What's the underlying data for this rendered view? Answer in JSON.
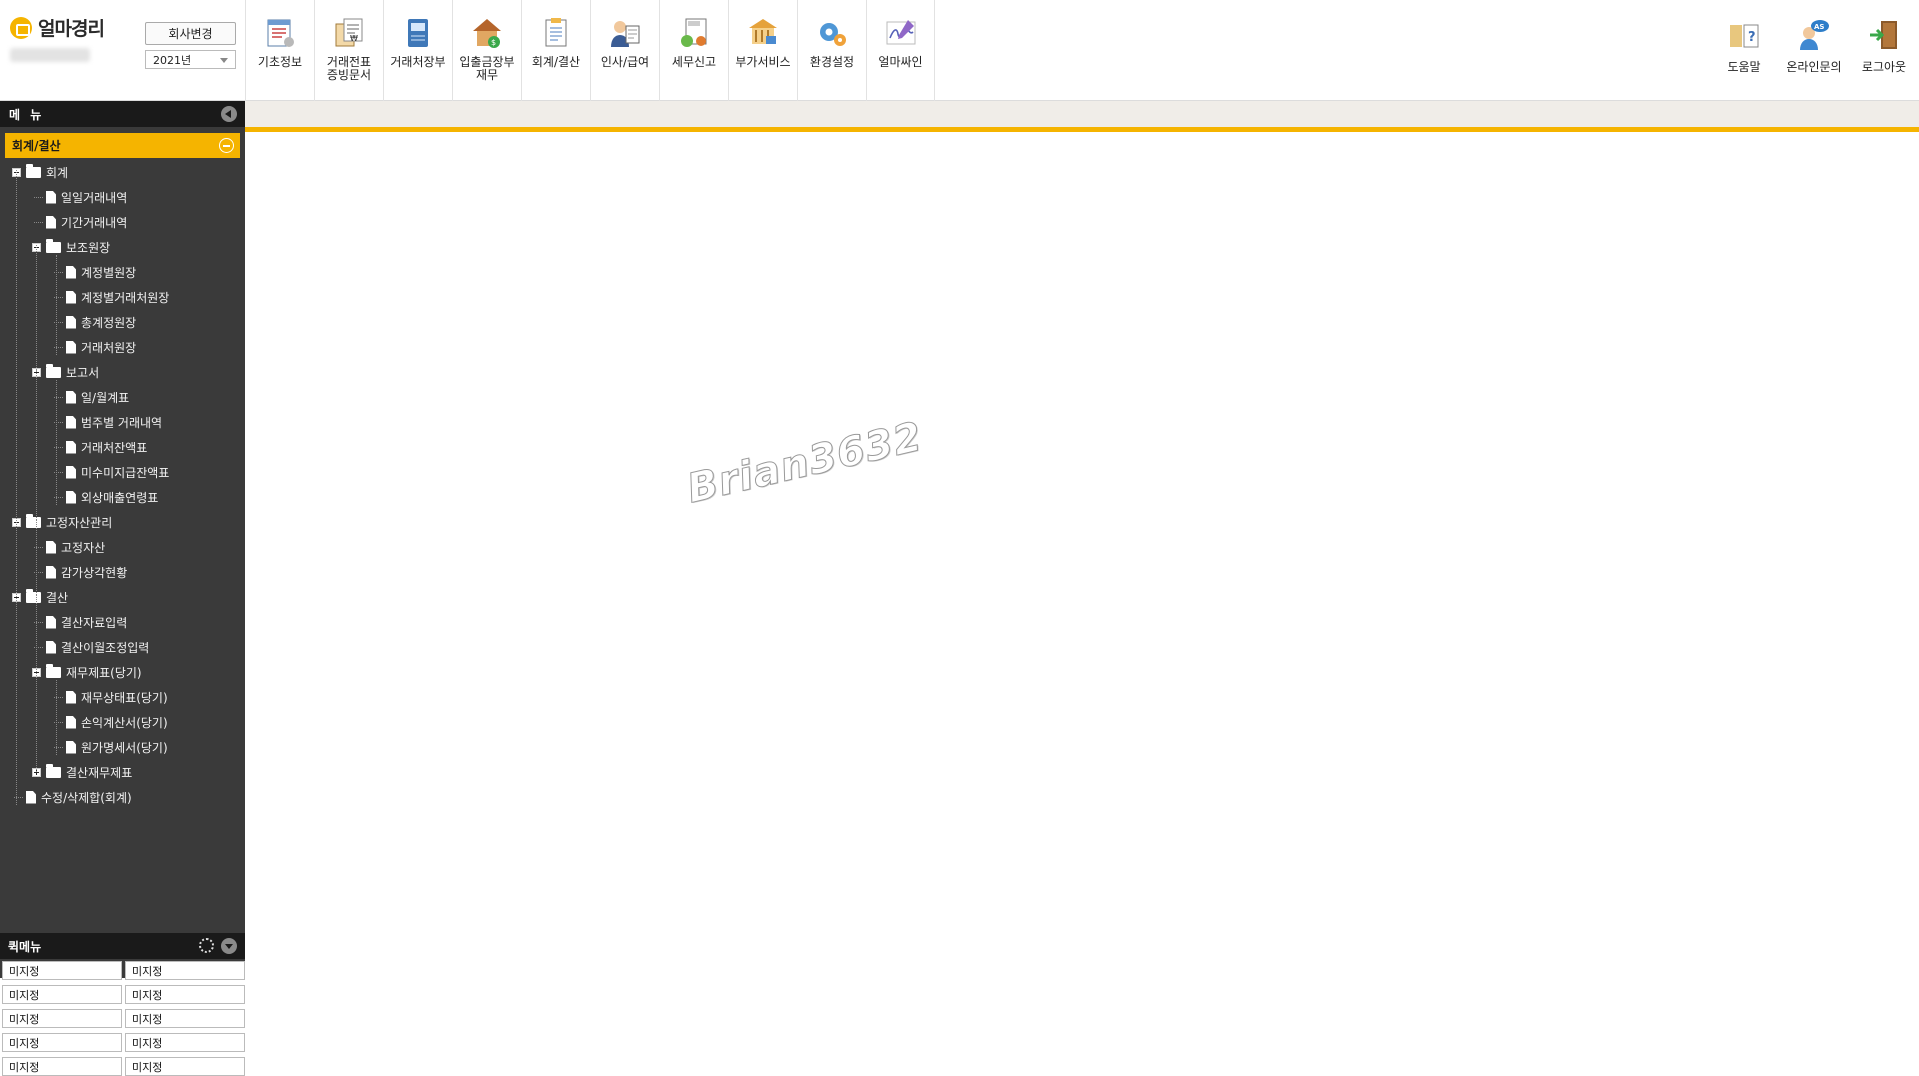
{
  "app": {
    "logo_text": "얼마경리"
  },
  "header": {
    "company_change": "회사변경",
    "year": "2021년"
  },
  "toolbar": [
    {
      "label": "기초정보",
      "icon": "basic-info-icon"
    },
    {
      "label": "거래전표\n증빙문서",
      "icon": "voucher-document-icon"
    },
    {
      "label": "거래처장부",
      "icon": "client-ledger-icon"
    },
    {
      "label": "입출금장부\n재무",
      "icon": "cashbook-finance-icon"
    },
    {
      "label": "회계/결산",
      "icon": "accounting-closing-icon"
    },
    {
      "label": "인사/급여",
      "icon": "hr-payroll-icon"
    },
    {
      "label": "세무신고",
      "icon": "tax-report-icon"
    },
    {
      "label": "부가서비스",
      "icon": "additional-service-icon"
    },
    {
      "label": "환경설정",
      "icon": "settings-icon"
    },
    {
      "label": "얼마싸인",
      "icon": "esign-icon"
    }
  ],
  "right_tools": [
    {
      "label": "도움말",
      "icon": "help-book-icon"
    },
    {
      "label": "온라인문의",
      "icon": "online-inquiry-icon"
    },
    {
      "label": "로그아웃",
      "icon": "logout-door-icon"
    }
  ],
  "sidebar": {
    "title": "메 뉴",
    "section": "회계/결산",
    "tree": [
      {
        "label": "회계",
        "type": "folder",
        "level": 0,
        "expanded": true
      },
      {
        "label": "일일거래내역",
        "type": "doc",
        "level": 1
      },
      {
        "label": "기간거래내역",
        "type": "doc",
        "level": 1
      },
      {
        "label": "보조원장",
        "type": "folder",
        "level": 1,
        "expanded": true
      },
      {
        "label": "계정별원장",
        "type": "doc",
        "level": 2
      },
      {
        "label": "계정별거래처원장",
        "type": "doc",
        "level": 2
      },
      {
        "label": "총계정원장",
        "type": "doc",
        "level": 2
      },
      {
        "label": "거래처원장",
        "type": "doc",
        "level": 2
      },
      {
        "label": "보고서",
        "type": "folder",
        "level": 1,
        "expanded": true
      },
      {
        "label": "일/월계표",
        "type": "doc",
        "level": 2
      },
      {
        "label": "범주별 거래내역",
        "type": "doc",
        "level": 2
      },
      {
        "label": "거래처잔액표",
        "type": "doc",
        "level": 2
      },
      {
        "label": "미수미지급잔액표",
        "type": "doc",
        "level": 2
      },
      {
        "label": "외상매출연령표",
        "type": "doc",
        "level": 2
      },
      {
        "label": "고정자산관리",
        "type": "folder",
        "level": 0,
        "expanded": true
      },
      {
        "label": "고정자산",
        "type": "doc",
        "level": 1
      },
      {
        "label": "감가상각현황",
        "type": "doc",
        "level": 1
      },
      {
        "label": "결산",
        "type": "folder",
        "level": 0,
        "expanded": true
      },
      {
        "label": "결산자료입력",
        "type": "doc",
        "level": 1
      },
      {
        "label": "결산이월조정입력",
        "type": "doc",
        "level": 1
      },
      {
        "label": "재무제표(당기)",
        "type": "folder",
        "level": 1,
        "expanded": true
      },
      {
        "label": "재무상태표(당기)",
        "type": "doc",
        "level": 2
      },
      {
        "label": "손익계산서(당기)",
        "type": "doc",
        "level": 2
      },
      {
        "label": "원가명세서(당기)",
        "type": "doc",
        "level": 2
      },
      {
        "label": "결산재무제표",
        "type": "folder",
        "level": 1,
        "expanded": false
      },
      {
        "label": "수정/삭제합(회계)",
        "type": "doc",
        "level": 0
      }
    ]
  },
  "quick_menu": {
    "title": "퀵메뉴",
    "items": [
      "미지정",
      "미지정",
      "미지정",
      "미지정",
      "미지정",
      "미지정",
      "미지정",
      "미지정",
      "미지정",
      "미지정"
    ]
  },
  "watermark": "Brian3632",
  "colors": {
    "accent": "#f5b400",
    "sidebar_bg": "#3a3a3a",
    "header_dark": "#1a1a1a"
  }
}
